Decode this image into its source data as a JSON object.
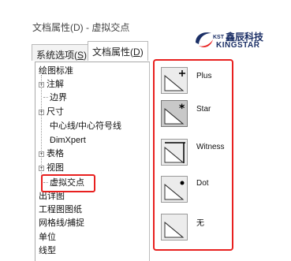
{
  "window": {
    "title": "文档属性(D) - 虚拟交点"
  },
  "logo": {
    "prefix": "KST",
    "name_cn": "鑫辰科技",
    "name_en": "KINGSTAR"
  },
  "tabs": [
    {
      "label": "系统选项",
      "shortcut": "S"
    },
    {
      "label": "文档属性",
      "shortcut": "D"
    }
  ],
  "tree": {
    "items": [
      {
        "label": "绘图标准"
      },
      {
        "label": "注解"
      },
      {
        "label": "边界"
      },
      {
        "label": "尺寸"
      },
      {
        "label": "中心线/中心符号线"
      },
      {
        "label": "DimXpert"
      },
      {
        "label": "表格"
      },
      {
        "label": "视图"
      },
      {
        "label": "虚拟交点"
      },
      {
        "label": "出详图"
      },
      {
        "label": "工程图图纸"
      },
      {
        "label": "网格线/捕捉"
      },
      {
        "label": "单位"
      },
      {
        "label": "线型"
      }
    ]
  },
  "point_options": [
    {
      "label": "Plus",
      "icon": "plus-symbol-icon",
      "selected": false
    },
    {
      "label": "Star",
      "icon": "star-symbol-icon",
      "selected": true
    },
    {
      "label": "Witness",
      "icon": "witness-lines-icon",
      "selected": false
    },
    {
      "label": "Dot",
      "icon": "dot-symbol-icon",
      "selected": false
    },
    {
      "label": "无",
      "icon": "no-symbol-icon",
      "selected": false
    }
  ],
  "colors": {
    "highlight": "#e8201f",
    "brand": "#1b2f66",
    "brand_accent": "#e8201f"
  }
}
